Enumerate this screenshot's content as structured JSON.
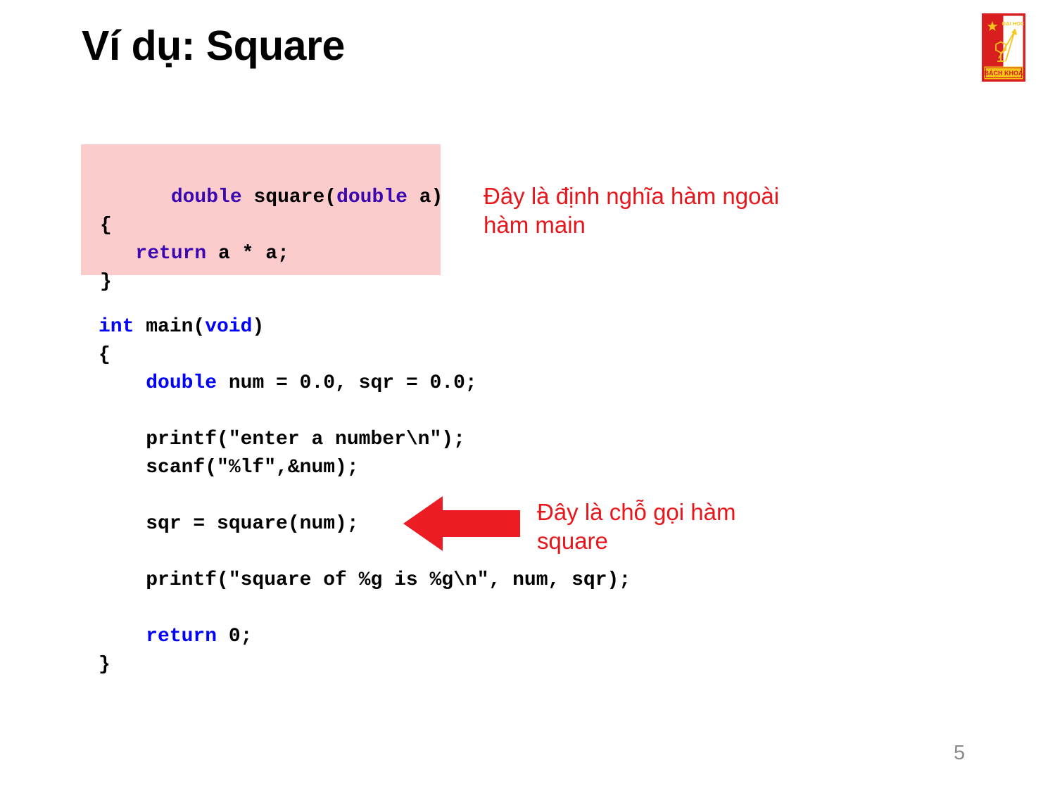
{
  "slide": {
    "title": "Ví dụ: Square",
    "page_number": "5",
    "background_color": "#ffffff"
  },
  "logo": {
    "name": "Bách Khoa university logo",
    "top_text": "ĐẠI HỌC",
    "banner_text": "BÁCH KHOA",
    "colors": {
      "red": "#d81e1e",
      "yellow": "#f5c518",
      "white": "#ffffff"
    }
  },
  "code_box": {
    "background_color": "#fccccc",
    "keyword_color": "#3A07B0",
    "lines": [
      {
        "segments": [
          {
            "t": "double",
            "kw": true
          },
          {
            "t": " square(",
            "kw": false
          },
          {
            "t": "double",
            "kw": true
          },
          {
            "t": " a)",
            "kw": false
          }
        ]
      },
      {
        "segments": [
          {
            "t": "{",
            "kw": false
          }
        ]
      },
      {
        "segments": [
          {
            "t": "   ",
            "kw": false
          },
          {
            "t": "return",
            "kw": true
          },
          {
            "t": " a * a;",
            "kw": false
          }
        ]
      },
      {
        "segments": [
          {
            "t": "}",
            "kw": false
          }
        ]
      }
    ],
    "plain_text": "double square(double a)\n{\n   return a * a;\n}"
  },
  "main_code": {
    "keyword_color": "#0000ff",
    "lines": [
      {
        "segments": [
          {
            "t": "int",
            "kw": true
          },
          {
            "t": " main(",
            "kw": false
          },
          {
            "t": "void",
            "kw": true
          },
          {
            "t": ")",
            "kw": false
          }
        ]
      },
      {
        "segments": [
          {
            "t": "{",
            "kw": false
          }
        ]
      },
      {
        "segments": [
          {
            "t": "    ",
            "kw": false
          },
          {
            "t": "double",
            "kw": true
          },
          {
            "t": " num = 0.0, sqr = 0.0;",
            "kw": false
          }
        ]
      },
      {
        "blank": true
      },
      {
        "segments": [
          {
            "t": "    printf(\"enter a number\\n\");",
            "kw": false
          }
        ]
      },
      {
        "segments": [
          {
            "t": "    scanf(\"%lf\",&num);",
            "kw": false
          }
        ]
      },
      {
        "blank": true
      },
      {
        "segments": [
          {
            "t": "    sqr = square(num);",
            "kw": false
          }
        ]
      },
      {
        "blank": true
      },
      {
        "segments": [
          {
            "t": "    printf(\"square of %g is %g\\n\", num, sqr);",
            "kw": false
          }
        ]
      },
      {
        "blank": true
      },
      {
        "segments": [
          {
            "t": "    ",
            "kw": false
          },
          {
            "t": "return",
            "kw": true
          },
          {
            "t": " 0;",
            "kw": false
          }
        ]
      },
      {
        "segments": [
          {
            "t": "}",
            "kw": false
          }
        ]
      }
    ],
    "plain_text": "int main(void)\n{\n    double num = 0.0, sqr = 0.0;\n\n    printf(\"enter a number\\n\");\n    scanf(\"%lf\",&num);\n\n    sqr = square(num);\n\n    printf(\"square of %g is %g\\n\", num, sqr);\n\n    return 0;\n}"
  },
  "annotations": {
    "color": "#e8161a",
    "note_definition": "Đây là định nghĩa hàm ngoài\nhàm main",
    "note_call": "Đây là chỗ gọi hàm\nsquare",
    "arrow_direction": "left",
    "arrow_color": "#ec1c24"
  }
}
